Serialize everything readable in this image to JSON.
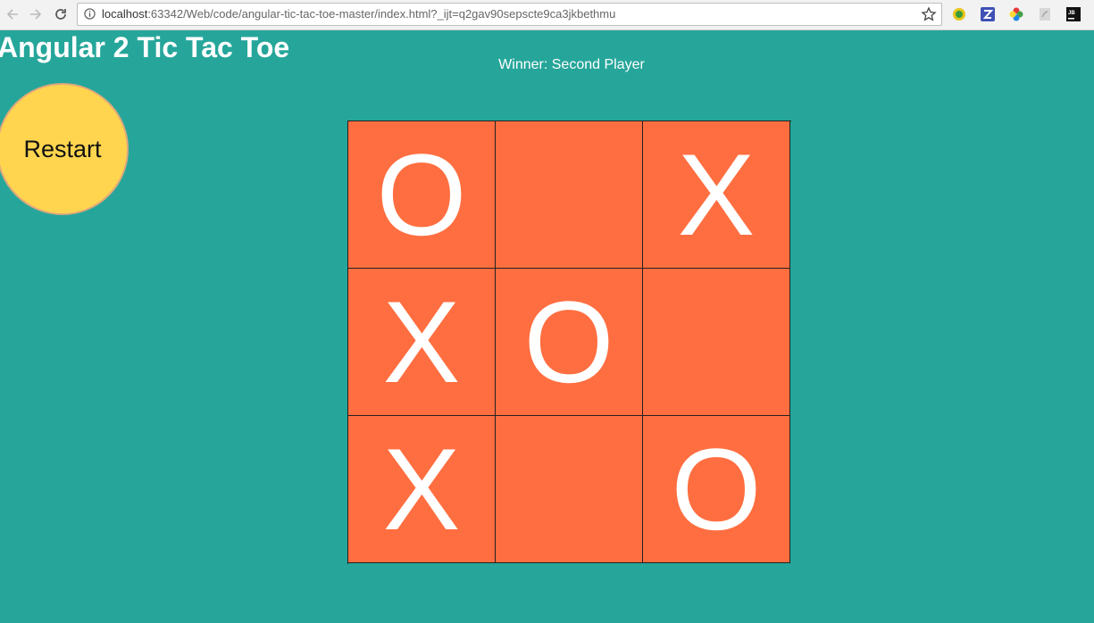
{
  "browser": {
    "url_host": "localhost",
    "url_rest": ":63342/Web/code/angular-tic-tac-toe-master/index.html?_ijt=q2gav90sepscte9ca3jkbethmu",
    "extension_icons": [
      "coin-extension-icon",
      "zotero-icon",
      "color-wheel-icon",
      "pdf-icon",
      "jetbrains-icon"
    ]
  },
  "page": {
    "title": "Angular 2 Tic Tac Toe",
    "status": "Winner: Second Player",
    "restart_label": "Restart"
  },
  "board": {
    "cells": [
      "O",
      "",
      "X",
      "X",
      "O",
      "",
      "X",
      "",
      "O"
    ]
  },
  "colors": {
    "background": "#26a69a",
    "cell": "#ff6e40",
    "restart": "#ffd54f",
    "mark": "#ffffff"
  }
}
